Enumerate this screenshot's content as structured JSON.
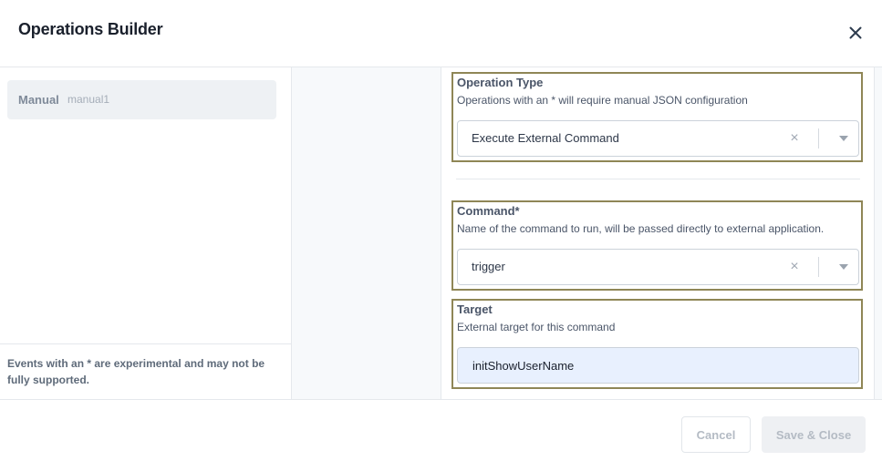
{
  "modal": {
    "title": "Operations Builder"
  },
  "events": {
    "items": [
      {
        "name": "Manual",
        "id": "manual1"
      }
    ],
    "footer_note": "Events with an * are experimental and may not be fully supported."
  },
  "operation_type": {
    "label": "Operation Type",
    "description": "Operations with an * will require manual JSON configuration",
    "value": "Execute External Command"
  },
  "command": {
    "label": "Command*",
    "description": "Name of the command to run, will be passed directly to external application.",
    "value": "trigger"
  },
  "target": {
    "label": "Target",
    "description": "External target for this command",
    "value": "initShowUserName"
  },
  "icons": {
    "close": "close-icon",
    "clear": "clear-icon",
    "chevron": "chevron-down-icon",
    "clear_glyph": "×"
  },
  "buttons": {
    "cancel": "Cancel",
    "save_close": "Save & Close"
  },
  "colors": {
    "highlight_border": "#8f8656",
    "input_autofill_bg": "#e8f0fe",
    "disabled_text": "#b4bbc4"
  }
}
